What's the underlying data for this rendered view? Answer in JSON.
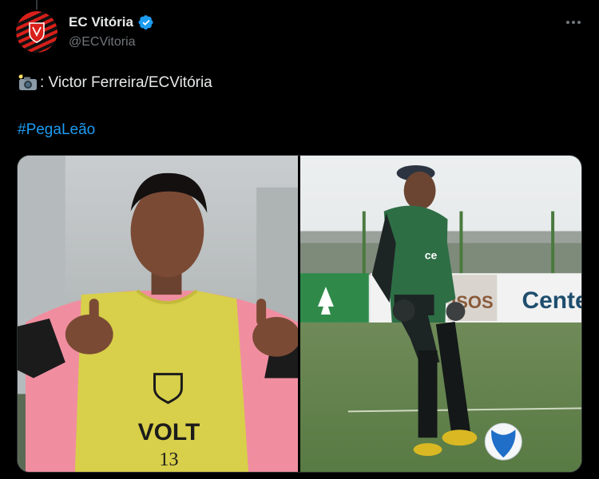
{
  "post": {
    "author": {
      "display_name": "EC Vitória",
      "handle": "@ECVitoria",
      "verified": true,
      "avatar_colors": [
        "#e0231b",
        "#111111"
      ]
    },
    "more_icon": "more-horizontal-icon",
    "credit": {
      "icon": "camera-flash-emoji",
      "text": ": Victor Ferreira/ECVitória"
    },
    "hashtag": "#PegaLeão",
    "media": [
      {
        "alt_subject": "player-thumbs-up",
        "bib_brand": "VOLT",
        "bib_number": "13"
      },
      {
        "alt_subject": "goalkeeper-with-ball",
        "jersey_sponsor": "ce",
        "board_text": "Cente",
        "board_text_2": "ISOS"
      }
    ]
  },
  "colors": {
    "background": "#000000",
    "text_primary": "#e7e9ea",
    "text_secondary": "#71767b",
    "link": "#1d9bf0",
    "verified": "#1d9bf0"
  }
}
